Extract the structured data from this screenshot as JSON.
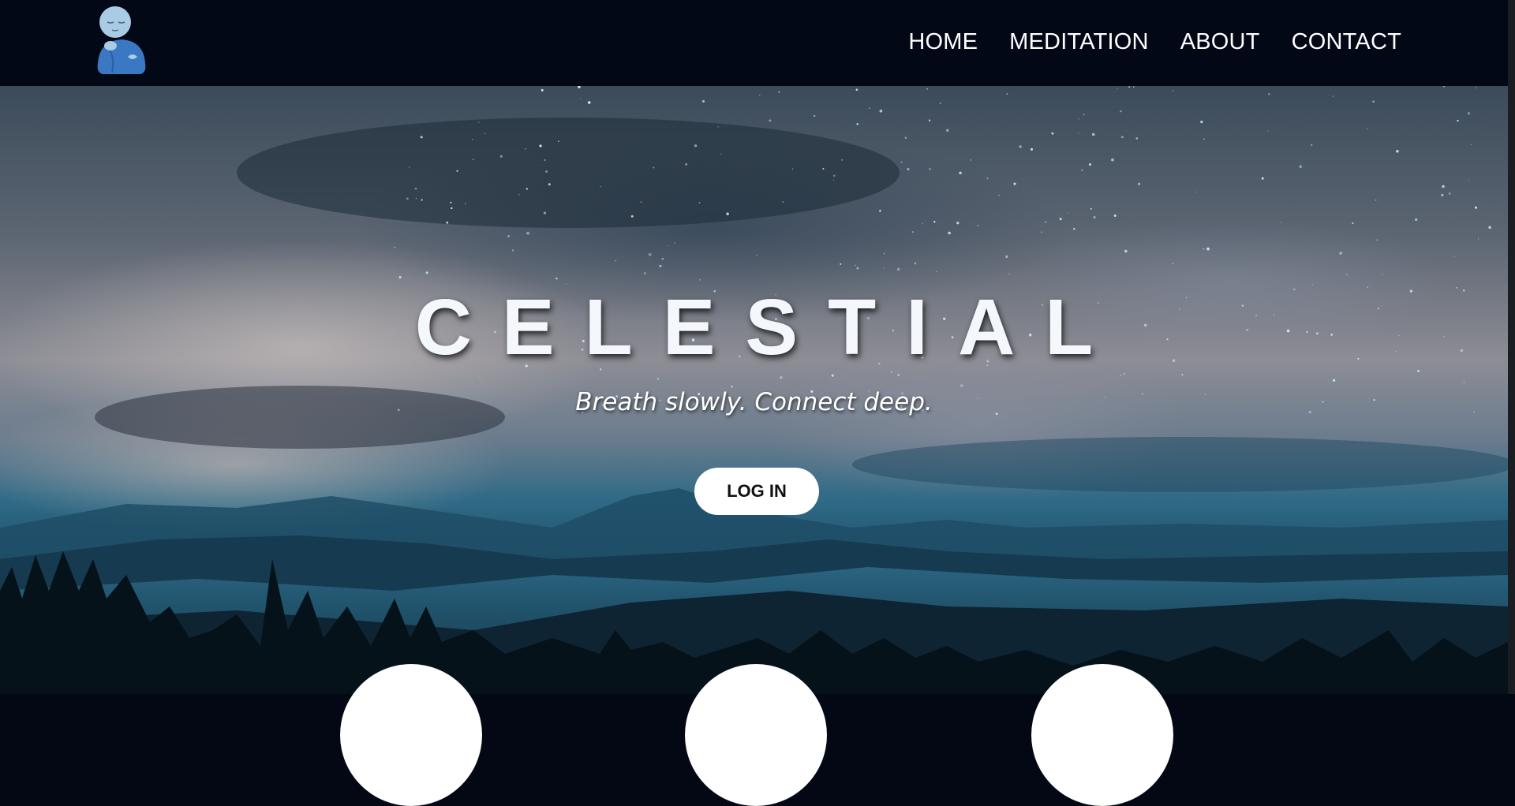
{
  "nav": {
    "logo_icon": "meditating-monk-icon",
    "links": [
      "HOME",
      "MEDITATION",
      "ABOUT",
      "CONTACT"
    ]
  },
  "hero": {
    "title": "CELESTIAL",
    "subtitle": "Breath slowly. Connect deep.",
    "login_label": "LOG IN",
    "background": "night-sky-mountains-image"
  },
  "feature_cards": [
    "white-circle-card-1",
    "white-circle-card-2",
    "white-circle-card-3"
  ],
  "colors": {
    "nav_bg": "#030816",
    "title": "#f4f7fb",
    "button_bg": "#ffffff",
    "button_text": "#111111"
  }
}
